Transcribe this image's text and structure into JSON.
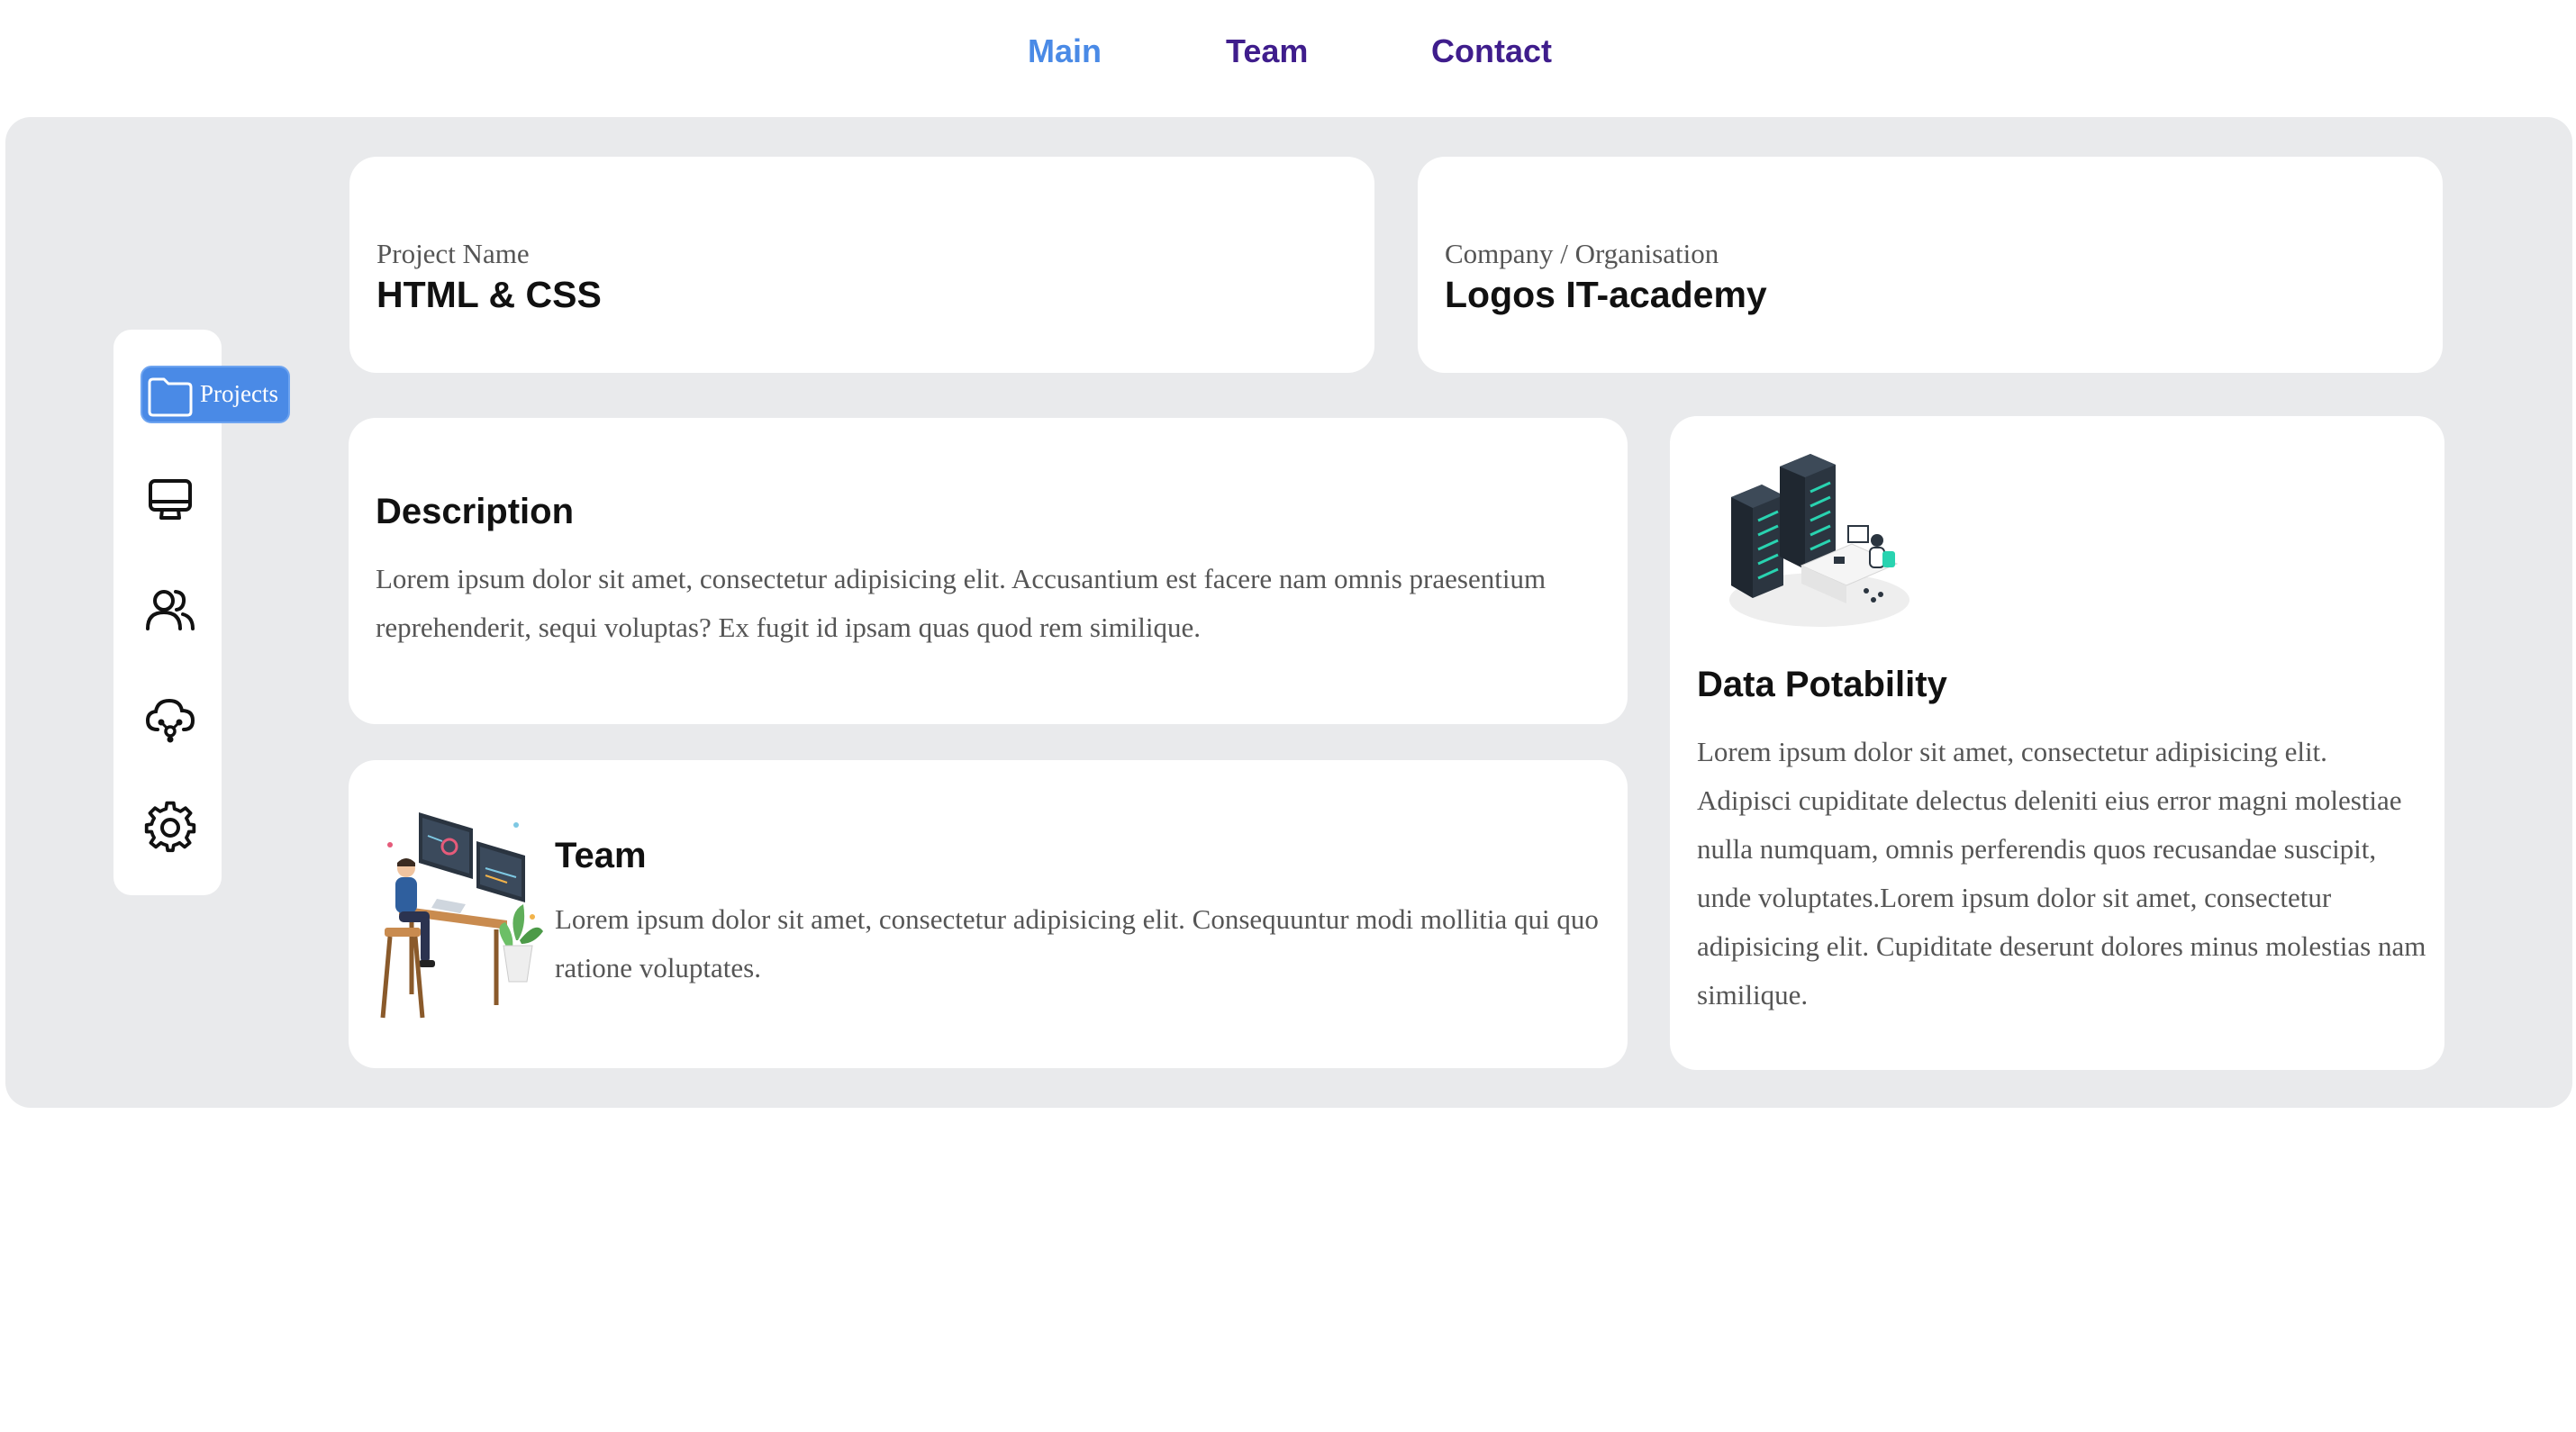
{
  "nav": {
    "items": [
      {
        "label": "Main",
        "active": true
      },
      {
        "label": "Team",
        "active": false
      },
      {
        "label": "Contact",
        "active": false
      }
    ]
  },
  "sidebar": {
    "active_item": {
      "label": "Projects",
      "icon": "folder-icon"
    },
    "items": [
      {
        "icon": "monitor-icon"
      },
      {
        "icon": "users-icon"
      },
      {
        "icon": "cloud-share-icon"
      },
      {
        "icon": "gear-icon"
      }
    ]
  },
  "project": {
    "label": "Project Name",
    "value": "HTML & CSS"
  },
  "company": {
    "label": "Company / Organisation",
    "value": "Logos IT-academy"
  },
  "description": {
    "title": "Description",
    "text": "Lorem ipsum dolor sit amet, consectetur adipisicing elit. Accusantium est facere nam omnis praesentium reprehenderit, sequi voluptas? Ex fugit id ipsam quas quod rem similique."
  },
  "team": {
    "title": "Team",
    "text": "Lorem ipsum dolor sit amet, consectetur adipisicing elit. Consequuntur modi mollitia qui quo ratione voluptates."
  },
  "data_card": {
    "title": "Data Potability",
    "text": "Lorem ipsum dolor sit amet, consectetur adipisicing elit. Adipisci cupiditate delectus deleniti eius error magni molestiae nulla numquam, omnis perferendis quos recusandae suscipit, unde voluptates.Lorem ipsum dolor sit amet, consectetur adipisicing elit. Cupiditate deserunt dolores minus molestias nam similique."
  },
  "colors": {
    "accent": "#4a8ae6",
    "nav_link": "#3f1d8c",
    "panel_bg": "#e9eaec",
    "card_bg": "#ffffff",
    "text_muted": "#555555"
  }
}
